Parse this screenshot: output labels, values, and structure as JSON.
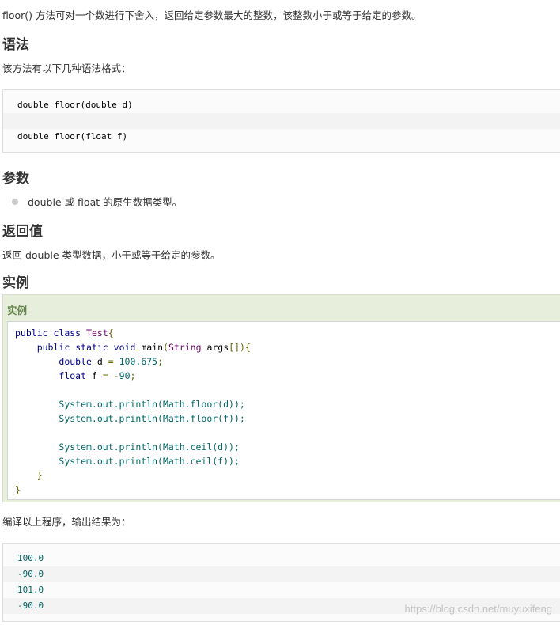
{
  "intro": "floor() 方法可对一个数进行下舍入，返回给定参数最大的整数，该整数小于或等于给定的参数。",
  "sections": {
    "syntax": {
      "heading": "语法",
      "desc": "该方法有以下几种语法格式：",
      "lines": [
        "double floor(double d)",
        "",
        "double floor(float f)"
      ]
    },
    "params": {
      "heading": "参数",
      "items": [
        "double 或 float 的原生数据类型。"
      ]
    },
    "returns": {
      "heading": "返回值",
      "desc": "返回 double 类型数据，小于或等于给定的参数。"
    },
    "example": {
      "heading": "实例",
      "box_title": "实例",
      "code": {
        "l1_kw1": "public",
        "l1_kw2": "class",
        "l1_name": "Test",
        "l1_brace": "{",
        "l2_kw1": "public",
        "l2_kw2": "static",
        "l2_kw3": "void",
        "l2_method": "main",
        "l2_open": "(",
        "l2_type": "String",
        "l2_arg": "args",
        "l2_close": "[]){",
        "l3_type": "double",
        "l3_var": "d",
        "l3_eq": "=",
        "l3_val": "100.675",
        "l3_semi": ";",
        "l4_type": "float",
        "l4_var": "f",
        "l4_eq": "=",
        "l4_minus": "-",
        "l4_val": "90",
        "l4_semi": ";",
        "l5": "System.out.println(Math.floor(d));",
        "l6": "System.out.println(Math.floor(f));",
        "l7": "System.out.println(Math.ceil(d));",
        "l8": "System.out.println(Math.ceil(f));",
        "l9": "}",
        "l10": "}"
      }
    },
    "output": {
      "desc": "编译以上程序，输出结果为：",
      "lines": [
        "100.0",
        "-90.0",
        "101.0",
        "-90.0"
      ]
    }
  },
  "watermark": "https://blog.csdn.net/muyuxifeng"
}
